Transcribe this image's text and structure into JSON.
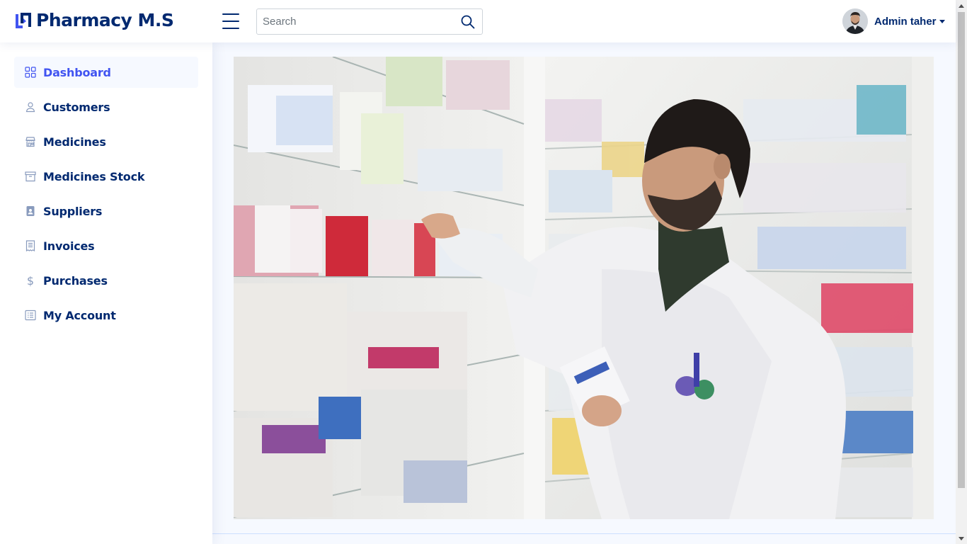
{
  "header": {
    "logo_text": "Pharmacy M.S",
    "search_placeholder": "Search",
    "search_value": "",
    "profile_name": "Admin taher"
  },
  "sidebar": {
    "items": [
      {
        "label": "Dashboard",
        "icon": "grid-icon",
        "active": true
      },
      {
        "label": "Customers",
        "icon": "person-icon",
        "active": false
      },
      {
        "label": "Medicines",
        "icon": "shop-icon",
        "active": false
      },
      {
        "label": "Medicines Stock",
        "icon": "archive-icon",
        "active": false
      },
      {
        "label": "Suppliers",
        "icon": "person-badge-icon",
        "active": false
      },
      {
        "label": "Invoices",
        "icon": "receipt-icon",
        "active": false
      },
      {
        "label": "Purchases",
        "icon": "dollar-icon",
        "active": false
      },
      {
        "label": "My Account",
        "icon": "account-list-icon",
        "active": false
      }
    ]
  },
  "main": {
    "hero_image": "pharmacist-stocking-shelves-photo"
  },
  "colors": {
    "brand": "#012970",
    "accent": "#4154f1",
    "icon_muted": "#899bbd",
    "background": "#f6f9ff"
  }
}
